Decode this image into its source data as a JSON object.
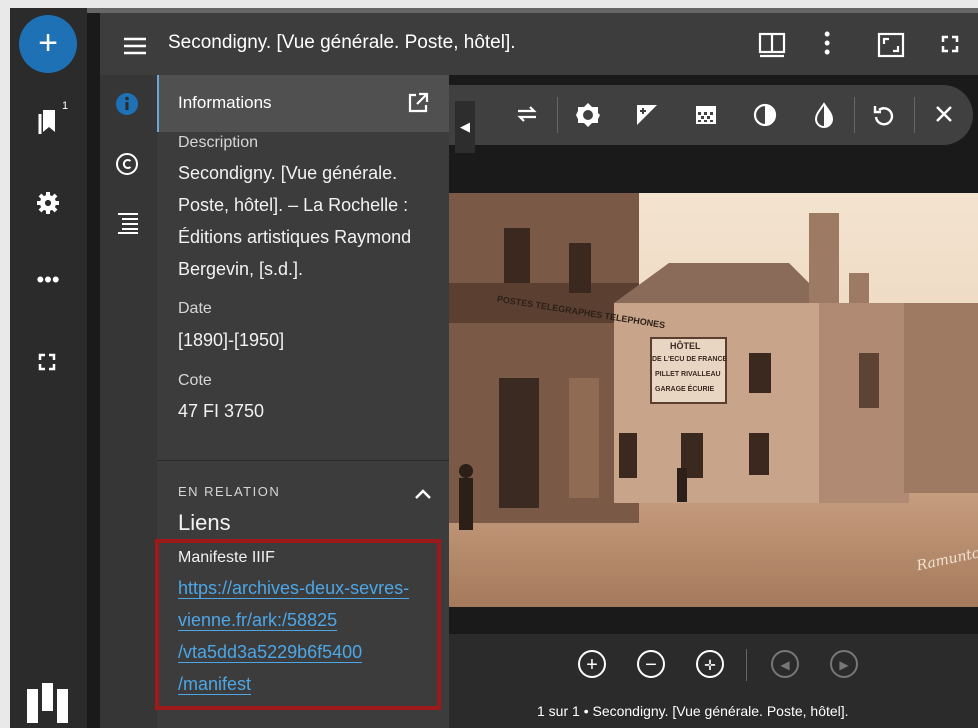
{
  "window": {
    "title": "Secondigny. [Vue générale. Poste, hôtel]."
  },
  "rail": {
    "add_icon": "plus-icon",
    "bookmark_badge": "1",
    "icons": [
      "bookmarks-icon",
      "settings-gear-icon",
      "more-horizontal-icon",
      "fullscreen-icon"
    ],
    "logo": "mirador-logo"
  },
  "header": {
    "icons": [
      "menu-icon",
      "window-layout-icon",
      "more-vertical-icon",
      "maximize-icon",
      "fullscreen-icon"
    ]
  },
  "sidestrip": {
    "icons": [
      "info-icon",
      "copyright-icon",
      "toc-list-icon"
    ]
  },
  "panel": {
    "heading": "Informations",
    "fields": [
      {
        "label": "Description",
        "value": "Secondigny. [Vue générale. Poste, hôtel]. – La Rochelle : Éditions artistiques Raymond Bergevin, [s.d.]."
      },
      {
        "label": "Date",
        "value": "[1890]-[1950]"
      },
      {
        "label": "Cote",
        "value": "47 FI 3750"
      }
    ],
    "related": {
      "section_label": "EN RELATION",
      "links_title": "Liens",
      "manifest_label": "Manifeste IIIF",
      "manifest_lines": [
        "https://archives-deux-sevres-",
        "vienne.fr/ark:/58825",
        "/vta5dd3a5229b6f5400",
        "/manifest"
      ]
    }
  },
  "image_toolbar": {
    "icons": [
      "flip-icon",
      "brightness-icon",
      "contrast-icon",
      "saturation-icon",
      "grayscale-icon",
      "invert-icon",
      "rotate-icon",
      "close-icon"
    ]
  },
  "image": {
    "signs": [
      "POSTES TELEGRAPHES TELEPHONES",
      "HÔTEL",
      "DE L'ECU DE FRANCE",
      "PILLET RIVALLEAU",
      "GARAGE ÉCURIE"
    ],
    "signature": "Ramuntcho"
  },
  "nav": {
    "icons": [
      "zoom-in-icon",
      "zoom-out-icon",
      "reset-zoom-icon",
      "previous-icon",
      "next-icon"
    ],
    "caption": "1 sur 1 • Secondigny. [Vue générale. Poste, hôtel]."
  },
  "colors": {
    "accent": "#1e71b5",
    "link": "#4da6e6",
    "highlight_box": "#9e1a1a"
  }
}
